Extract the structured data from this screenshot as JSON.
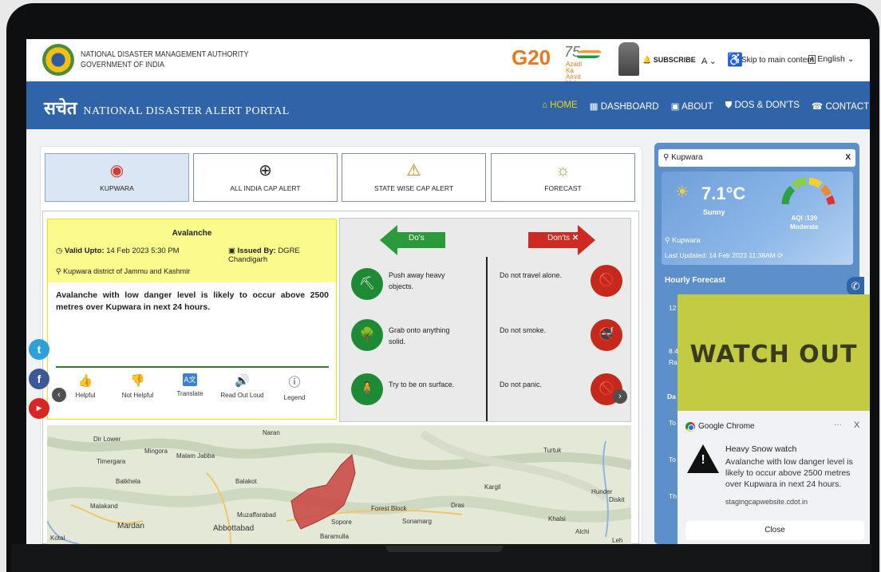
{
  "header": {
    "org_line1": "NATIONAL DISASTER MANAGEMENT AUTHORITY",
    "org_line2": "GOVERNMENT OF INDIA",
    "g20_logo": "G20",
    "azadi_line1": "Azadi",
    "azadi_line2": "Ka",
    "azadi_line3": "Amrit Mahotsav",
    "subscribe": "SUBSCRIBE",
    "font_size": "A",
    "skip": "Skip to main content",
    "language": "English"
  },
  "nav": {
    "brand_hindi": "सचेत",
    "brand_english": "NATIONAL DISASTER ALERT PORTAL",
    "items": [
      {
        "label": "HOME",
        "icon": "home-icon"
      },
      {
        "label": "DASHBOARD",
        "icon": "grid-icon"
      },
      {
        "label": "ABOUT",
        "icon": "book-icon"
      },
      {
        "label": "DOS & DON'TS",
        "icon": "shield-icon"
      },
      {
        "label": "CONTACT",
        "icon": "contact-icon"
      }
    ]
  },
  "tabs": [
    {
      "label": "KUPWARA",
      "icon": "location-pin-icon"
    },
    {
      "label": "ALL INDIA CAP ALERT",
      "icon": "crosshair-pin-icon"
    },
    {
      "label": "STATE WISE CAP ALERT",
      "icon": "warning-search-icon"
    },
    {
      "label": "FORECAST",
      "icon": "weather-forecast-icon"
    }
  ],
  "alert": {
    "title": "Avalanche",
    "valid_label": "Valid Upto:",
    "valid_value": "14 Feb 2023 5:30 PM",
    "issued_label": "Issued By:",
    "issued_value": "DGRE Chandigarh",
    "area": "Kupwara district of Jammu and Kashmir",
    "description": "Avalanche with low danger level is likely to occur above 2500 metres over Kupwara in next 24 hours.",
    "actions": [
      "Helpful",
      "Not Helpful",
      "Translate",
      "Read Out Loud",
      "Legend"
    ]
  },
  "dos_donts": {
    "dos_label": "Do's",
    "donts_label": "Don'ts",
    "dos": [
      "Push away heavy objects.",
      "Grab onto anything solid.",
      "Try to be on surface."
    ],
    "donts": [
      "Do not travel alone.",
      "Do not smoke.",
      "Do not panic."
    ]
  },
  "map": {
    "labels": [
      "Dir Lower",
      "Mingora",
      "Malam Jabba",
      "Timergara",
      "Batkhela",
      "Balakot",
      "Malakand",
      "Mardan",
      "Abbottabad",
      "Muzaffarabad",
      "Naran",
      "Turtuk",
      "Kargil",
      "Dras",
      "Forest Block",
      "Sopore",
      "Sonamarg",
      "Baramulla",
      "Hunder",
      "Diskit",
      "Khalsi",
      "Alchi",
      "Kotal",
      "Leh"
    ],
    "alert_color": "#c9433f"
  },
  "weather": {
    "location": "Kupwara",
    "temperature": "7.1°C",
    "condition": "Sunny",
    "aqi": "AQI :139",
    "aqi_status": "Moderate",
    "place": "Kupwara",
    "last_updated_label": "Last Updated:",
    "last_updated_value": "14 Feb 2023 11:38AM",
    "hourly_title": "Hourly Forecast",
    "side_items": [
      "12",
      "8.4",
      "Ra",
      "Da",
      "To",
      "To",
      "Th"
    ]
  },
  "notification": {
    "banner": "WATCH OUT",
    "app": "Google Chrome",
    "more": "···",
    "close_x": "X",
    "title": "Heavy Snow watch",
    "body": "Avalanche with low danger level is likely to occur above 2500 metres over Kupwara in next 24 hours.",
    "site": "stagingcapwebsite.cdot.in",
    "button": "Close"
  },
  "colors": {
    "nav_bg": "#2f64a9",
    "accent_yellow": "#f5d50c",
    "alert_yellow": "#fafa8d",
    "do_green": "#1e8a35",
    "dont_red": "#c4291b",
    "watch_bg": "#c2cb42"
  }
}
